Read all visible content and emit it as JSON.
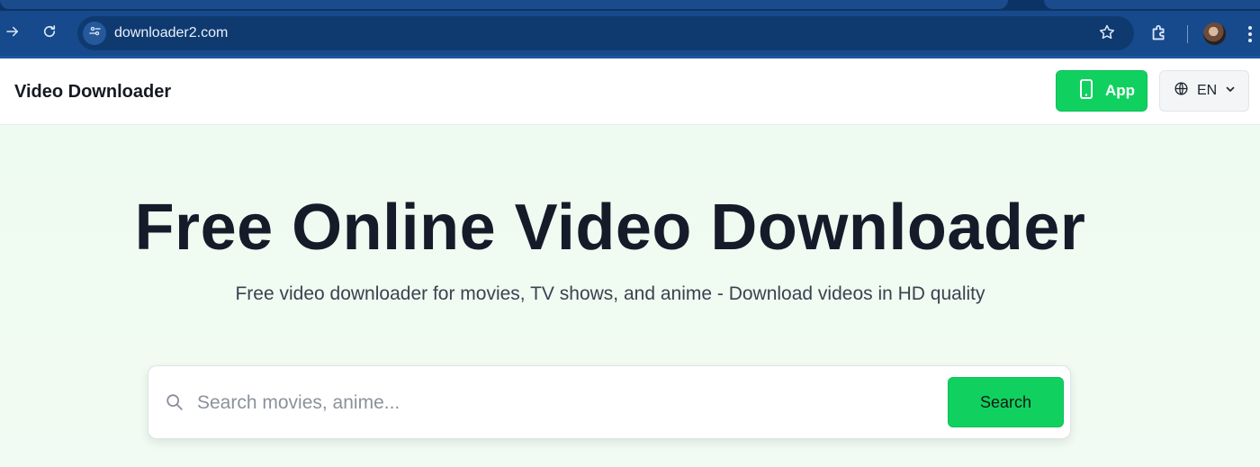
{
  "browser": {
    "url": "downloader2.com"
  },
  "header": {
    "logo": "Video Downloader",
    "app_label": "App",
    "lang_label": "EN"
  },
  "hero": {
    "title": "Free Online Video Downloader",
    "subtitle": "Free video downloader for movies, TV shows, and anime - Download videos in HD quality"
  },
  "search": {
    "placeholder": "Search movies, anime...",
    "value": "",
    "button_label": "Search"
  },
  "icons": {
    "forward": "arrow-right-icon",
    "reload": "reload-icon",
    "site_info": "tune-icon",
    "bookmark": "star-icon",
    "extensions": "puzzle-icon",
    "menu": "kebab-menu-icon",
    "app": "phone-icon",
    "language": "globe-icon",
    "dropdown": "chevron-down-icon",
    "search": "search-icon"
  },
  "colors": {
    "accent": "#10d15f",
    "chrome": "#174a8c",
    "hero_bg": "#eefbf0",
    "title": "#161b2a"
  }
}
